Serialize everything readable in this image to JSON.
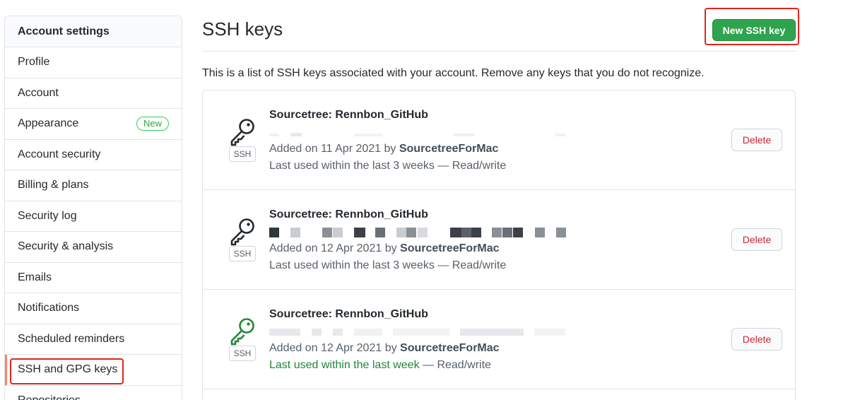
{
  "sidebar": {
    "header": "Account settings",
    "items": [
      {
        "label": "Profile"
      },
      {
        "label": "Account"
      },
      {
        "label": "Appearance",
        "badge": "New"
      },
      {
        "label": "Account security"
      },
      {
        "label": "Billing & plans"
      },
      {
        "label": "Security log"
      },
      {
        "label": "Security & analysis"
      },
      {
        "label": "Emails"
      },
      {
        "label": "Notifications"
      },
      {
        "label": "Scheduled reminders"
      },
      {
        "label": "SSH and GPG keys",
        "selected": true
      },
      {
        "label": "Repositories"
      }
    ]
  },
  "main": {
    "title": "SSH keys",
    "new_button": "New SSH key",
    "intro": "This is a list of SSH keys associated with your account. Remove any keys that you do not recognize.",
    "keys": [
      {
        "title": "Sourcetree: Rennbon_GitHub",
        "tag": "SSH",
        "added_prefix": "Added on 11 Apr 2021 by ",
        "added_by": "SourcetreeForMac",
        "last_used_recent": "",
        "last_used": "Last used within the last 3 weeks — Read/write",
        "delete": "Delete",
        "icon_color": "#24292e"
      },
      {
        "title": "Sourcetree: Rennbon_GitHub",
        "tag": "SSH",
        "added_prefix": "Added on 12 Apr 2021 by ",
        "added_by": "SourcetreeForMac",
        "last_used_recent": "",
        "last_used": "Last used within the last 3 weeks — Read/write",
        "delete": "Delete",
        "icon_color": "#24292e"
      },
      {
        "title": "Sourcetree: Rennbon_GitHub",
        "tag": "SSH",
        "added_prefix": "Added on 12 Apr 2021 by ",
        "added_by": "SourcetreeForMac",
        "last_used_recent": "Last used within the last week",
        "last_used": " — Read/write",
        "delete": "Delete",
        "icon_color": "#22863a"
      }
    ]
  },
  "colors": {
    "primary_button": "#2ea44f",
    "danger": "#cb2431",
    "recent_green": "#22863a",
    "highlight_red": "#e0251c"
  },
  "icons": [
    "key-icon"
  ]
}
